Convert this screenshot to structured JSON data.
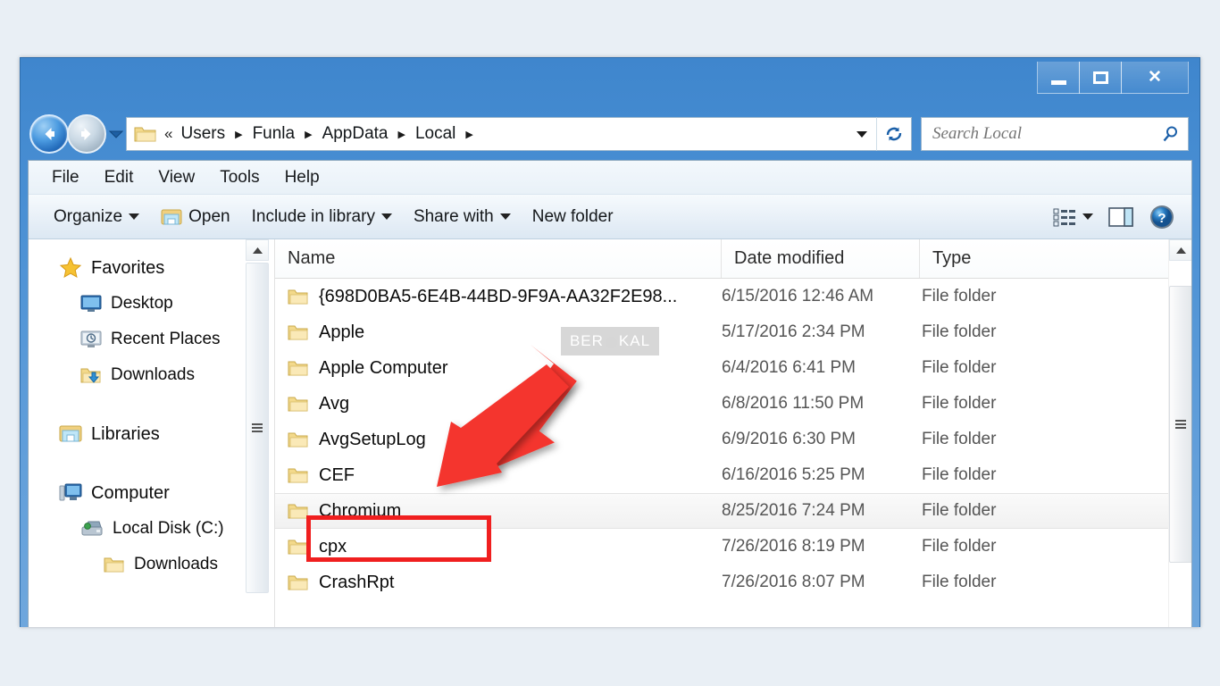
{
  "window": {
    "controls": {
      "minimize_label": "Minimize",
      "maximize_label": "Maximize",
      "close_label": "✕"
    }
  },
  "address": {
    "back_label": "Back",
    "forward_label": "Forward",
    "recent_dropdown_label": "Recent pages",
    "leading_chevrons": "«",
    "crumbs": [
      "Users",
      "Funla",
      "AppData",
      "Local"
    ],
    "separator": "▶",
    "trailing_separator": "▶",
    "dropdown_label": "Previous locations",
    "refresh_label": "Refresh"
  },
  "search": {
    "placeholder": "Search Local",
    "value": "",
    "icon": "search-icon"
  },
  "menubar": {
    "items": [
      "File",
      "Edit",
      "View",
      "Tools",
      "Help"
    ]
  },
  "toolbar": {
    "organize_label": "Organize",
    "open_label": "Open",
    "include_label": "Include in library",
    "share_label": "Share with",
    "newfolder_label": "New folder",
    "view_label": "Change your view",
    "preview_label": "Show the preview pane",
    "help_label": "Get help"
  },
  "navpane": {
    "items": [
      {
        "label": "Favorites",
        "icon": "star-icon",
        "level": 0
      },
      {
        "label": "Desktop",
        "icon": "desktop-icon",
        "level": 1
      },
      {
        "label": "Recent Places",
        "icon": "recent-icon",
        "level": 1
      },
      {
        "label": "Downloads",
        "icon": "downloads-icon",
        "level": 1
      },
      {
        "label": "Libraries",
        "icon": "libraries-icon",
        "level": 0
      },
      {
        "label": "Computer",
        "icon": "computer-icon",
        "level": 0
      },
      {
        "label": "Local Disk (C:)",
        "icon": "harddisk-icon",
        "level": 1
      },
      {
        "label": "Downloads",
        "icon": "folder-icon",
        "level": 2
      }
    ]
  },
  "filelist": {
    "columns": [
      "Name",
      "Date modified",
      "Type"
    ],
    "sort_column": "Name",
    "rows": [
      {
        "name": "{698D0BA5-6E4B-44BD-9F9A-AA32F2E98...",
        "date": "6/15/2016 12:46 AM",
        "type": "File folder",
        "selected": false
      },
      {
        "name": "Apple",
        "date": "5/17/2016 2:34 PM",
        "type": "File folder",
        "selected": false
      },
      {
        "name": "Apple Computer",
        "date": "6/4/2016 6:41 PM",
        "type": "File folder",
        "selected": false
      },
      {
        "name": "Avg",
        "date": "6/8/2016 11:50 PM",
        "type": "File folder",
        "selected": false
      },
      {
        "name": "AvgSetupLog",
        "date": "6/9/2016 6:30 PM",
        "type": "File folder",
        "selected": false
      },
      {
        "name": "CEF",
        "date": "6/16/2016 5:25 PM",
        "type": "File folder",
        "selected": false
      },
      {
        "name": "Chromium",
        "date": "8/25/2016 7:24 PM",
        "type": "File folder",
        "selected": true
      },
      {
        "name": "cpx",
        "date": "7/26/2016 8:19 PM",
        "type": "File folder",
        "selected": false
      },
      {
        "name": "CrashRpt",
        "date": "7/26/2016 8:07 PM",
        "type": "File folder",
        "selected": false
      }
    ]
  },
  "annotations": {
    "highlight_color": "#f01f1f",
    "highlight_target": "Chromium",
    "arrow_color": "#f4342e",
    "watermark_text_left": "BER",
    "watermark_text_right": "KAL"
  }
}
